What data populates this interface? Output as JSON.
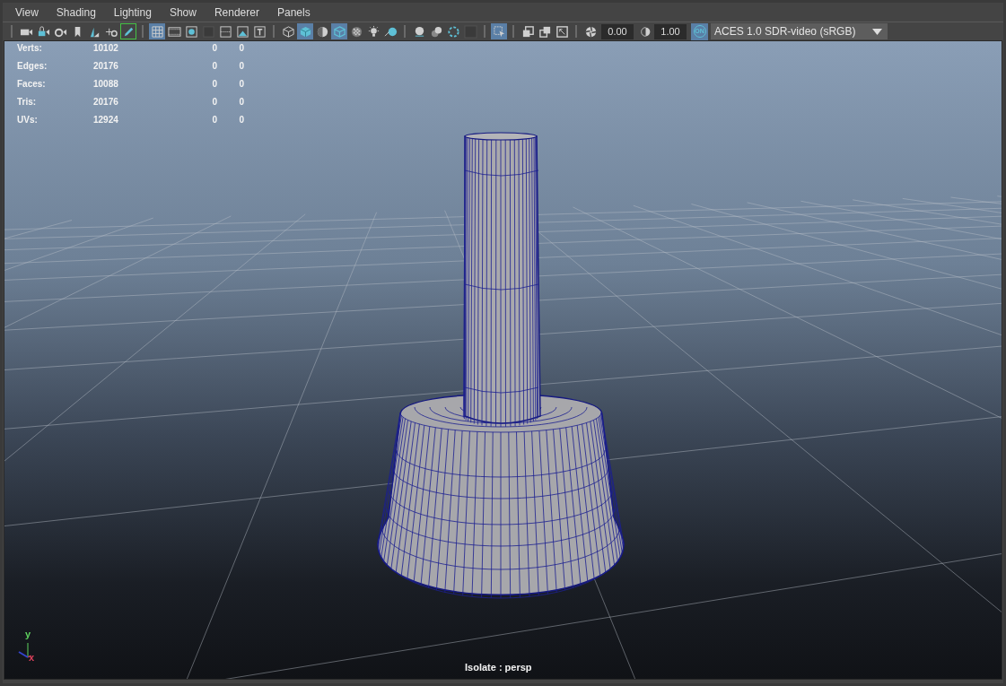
{
  "menu": [
    "View",
    "Shading",
    "Lighting",
    "Show",
    "Renderer",
    "Panels"
  ],
  "toolbar": {
    "buttons": [
      {
        "selected": false
      },
      {
        "selected": false
      },
      {
        "selected": false
      },
      {
        "selected": false
      },
      {
        "selected": false
      },
      {
        "selected": false
      },
      {
        "selected": true
      },
      {
        "selected": true
      },
      {
        "selected": false
      },
      {
        "selected": false
      },
      {
        "selected": false
      },
      {
        "selected": false
      },
      {
        "selected": false
      },
      {
        "selected": false
      },
      {
        "selected": false
      },
      {
        "selected": true
      },
      {
        "selected": false
      },
      {
        "selected": true
      },
      {
        "selected": false
      },
      {
        "selected": false
      },
      {
        "selected": false
      },
      {
        "selected": false
      },
      {
        "selected": false
      },
      {
        "selected": false
      },
      {
        "selected": false
      },
      {
        "selected": true
      },
      {
        "selected": false
      },
      {
        "selected": false
      },
      {
        "selected": false
      },
      {
        "selected": false
      }
    ],
    "exposure": "0.00",
    "gamma": "1.00",
    "color_management": {
      "label": "ON",
      "selected": true
    },
    "view_transform": "ACES 1.0 SDR-video (sRGB)"
  },
  "stats": [
    {
      "label": "Verts:",
      "values": [
        "10102",
        "0",
        "0"
      ]
    },
    {
      "label": "Edges:",
      "values": [
        "20176",
        "0",
        "0"
      ]
    },
    {
      "label": "Faces:",
      "values": [
        "10088",
        "0",
        "0"
      ]
    },
    {
      "label": "Tris:",
      "values": [
        "20176",
        "0",
        "0"
      ]
    },
    {
      "label": "UVs:",
      "values": [
        "12924",
        "0",
        "0"
      ]
    }
  ],
  "axis_labels": [
    {
      "text": "y",
      "color": "#5fd35f"
    },
    {
      "text": "x",
      "color": "#d8405a"
    }
  ],
  "camera_label": "Isolate : persp"
}
